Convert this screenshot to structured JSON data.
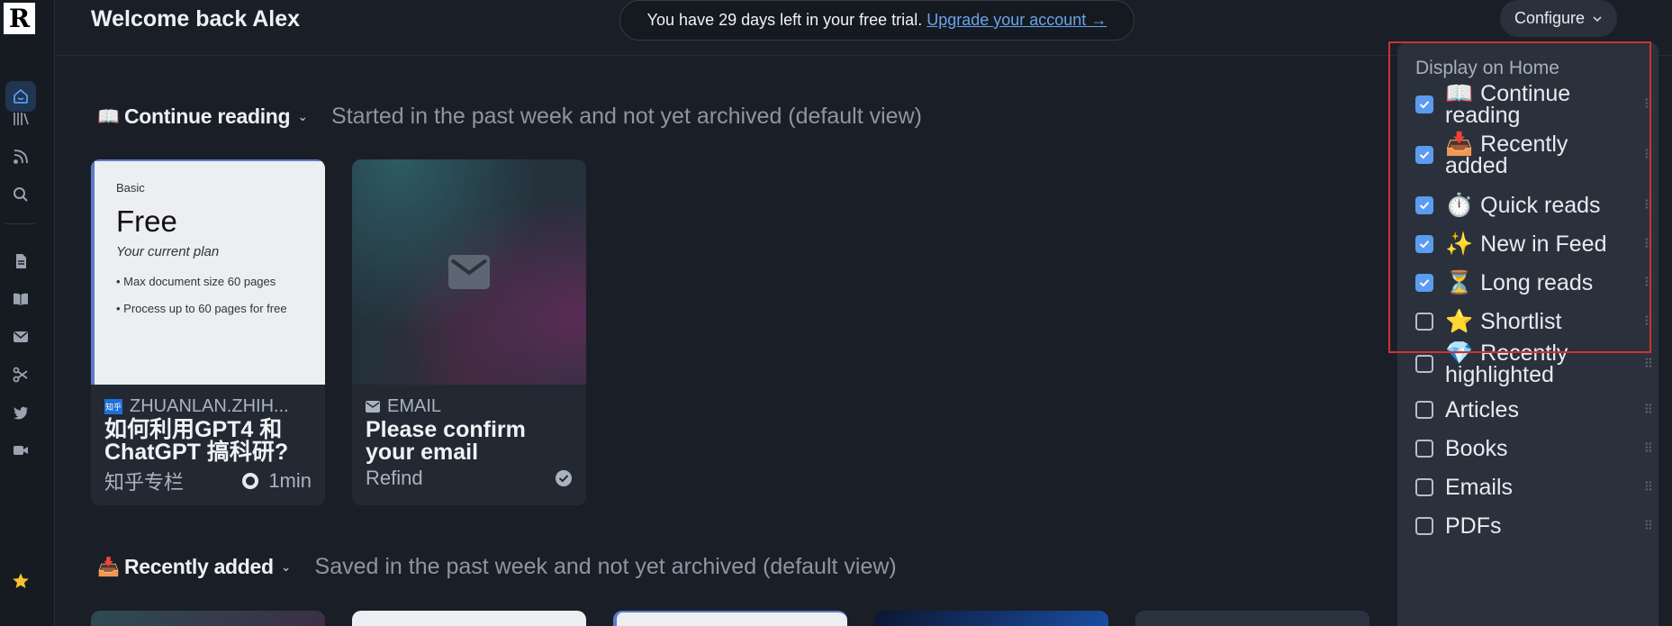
{
  "app": {
    "logo_letter": "R"
  },
  "header": {
    "welcome": "Welcome back Alex",
    "trial_text": "You have 29 days left in your free trial.",
    "trial_link": "Upgrade your account →",
    "configure_label": "Configure"
  },
  "sections": [
    {
      "emoji": "📖",
      "title": "Continue reading",
      "desc": "Started in the past week and not yet archived (default view)"
    },
    {
      "emoji": "📥",
      "title": "Recently added",
      "desc": "Saved in the past week and not yet archived (default view)"
    }
  ],
  "cards": [
    {
      "plan": {
        "tier": "Basic",
        "name": "Free",
        "subtitle": "Your current plan",
        "bullet1": "• Max document size 60 pages",
        "bullet2": "• Process up to 60 pages for free"
      },
      "badge": "知乎",
      "source": "ZHUANLAN.ZHIH...",
      "title": "如何利用GPT4 和 ChatGPT 搞科研?",
      "author": "知乎专栏",
      "read_time": "1min"
    },
    {
      "source": "EMAIL",
      "title": "Please confirm your email",
      "author": "Refind"
    }
  ],
  "menu": {
    "heading": "Display on Home",
    "items": [
      {
        "emoji": "📖",
        "label": "Continue reading",
        "checked": true
      },
      {
        "emoji": "📥",
        "label": "Recently added",
        "checked": true
      },
      {
        "emoji": "⏱️",
        "label": "Quick reads",
        "checked": true
      },
      {
        "emoji": "✨",
        "label": "New in Feed",
        "checked": true
      },
      {
        "emoji": "⏳",
        "label": "Long reads",
        "checked": true
      },
      {
        "emoji": "⭐",
        "label": "Shortlist",
        "checked": false
      },
      {
        "emoji": "💎",
        "label": "Recently highlighted",
        "checked": false
      },
      {
        "emoji": "",
        "label": "Articles",
        "checked": false
      },
      {
        "emoji": "",
        "label": "Books",
        "checked": false
      },
      {
        "emoji": "",
        "label": "Emails",
        "checked": false
      },
      {
        "emoji": "",
        "label": "PDFs",
        "checked": false
      }
    ]
  },
  "colors": {
    "accent": "#5b9bf0",
    "background": "#1a1f27",
    "highlight": "#d0312d"
  }
}
